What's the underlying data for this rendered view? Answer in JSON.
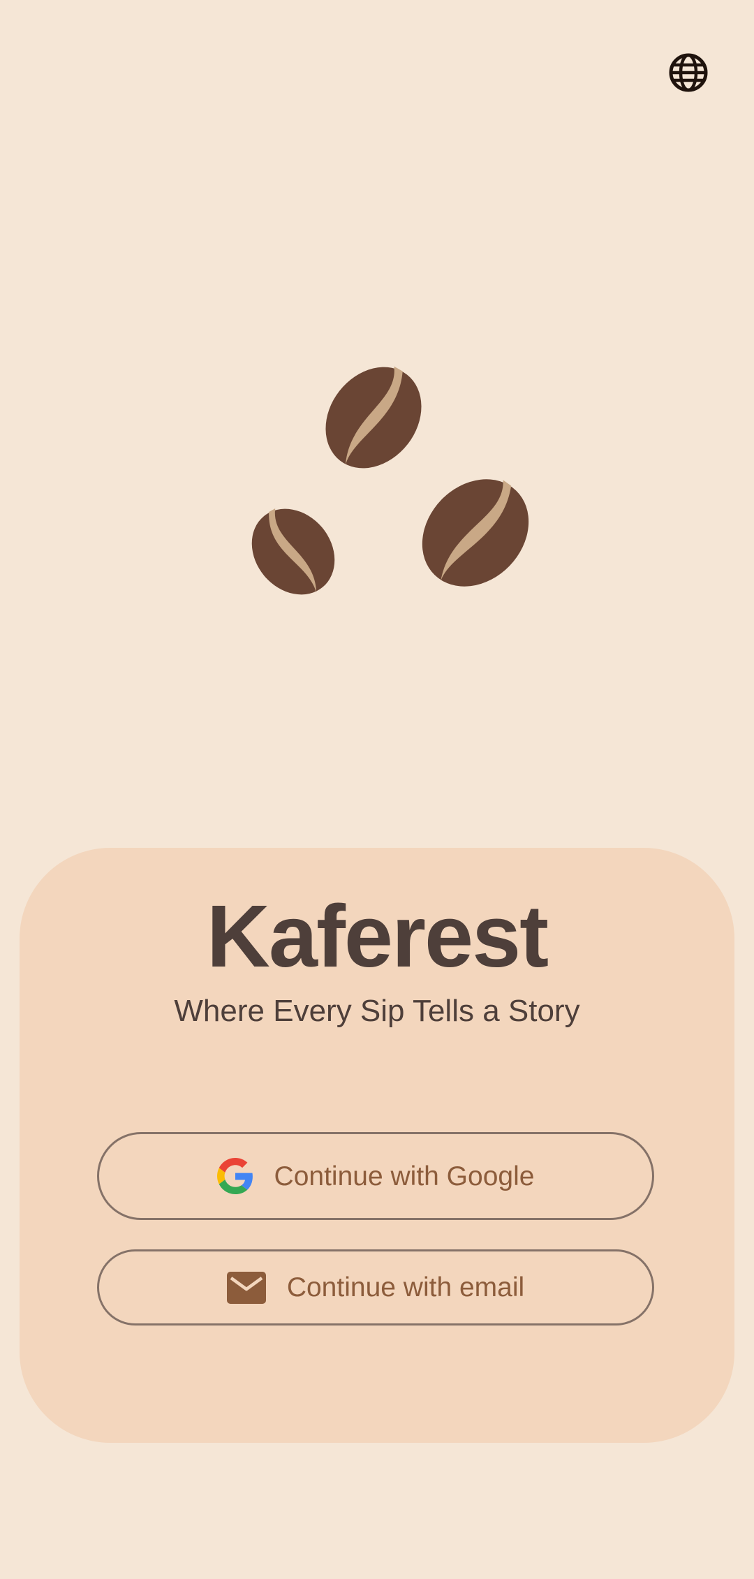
{
  "app": {
    "title": "Kaferest",
    "tagline": "Where Every Sip Tells a Story"
  },
  "header": {
    "language_icon": "globe-icon"
  },
  "illustration": {
    "icon": "coffee-beans-icon",
    "bean_color": "#6a4534",
    "crease_color": "#c9a886"
  },
  "auth": {
    "google_label": "Continue with Google",
    "google_icon": "google-logo-icon",
    "email_label": "Continue with email",
    "email_icon": "mail-icon"
  },
  "colors": {
    "background": "#f5e6d6",
    "sheet": "#f3d6bd",
    "title_text": "#4e3f3a",
    "button_text": "#8c5c3b",
    "button_border": "#857268"
  }
}
